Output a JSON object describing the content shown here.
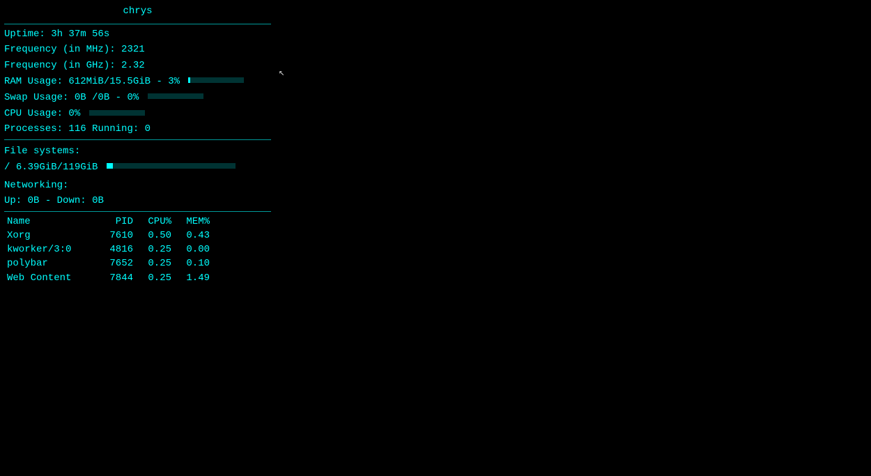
{
  "title": "chrys",
  "system": {
    "uptime_label": "Uptime:",
    "uptime_value": "3h 37m 56s",
    "freq_mhz_label": "Frequency (in MHz):",
    "freq_mhz_value": "2321",
    "freq_ghz_label": "Frequency (in GHz):",
    "freq_ghz_value": "2.32",
    "ram_label": "RAM Usage:",
    "ram_value": "612MiB/15.5GiB",
    "ram_pct": "- 3%",
    "ram_bar_pct": 3,
    "swap_label": "Swap Usage:",
    "swap_value": "0B  /0B",
    "swap_pct": "- 0%",
    "swap_bar_pct": 0,
    "cpu_label": "CPU Usage:",
    "cpu_pct": "0%",
    "cpu_bar_pct": 0,
    "proc_label": "Processes:",
    "proc_count": "116",
    "proc_running_label": "Running:",
    "proc_running": "0"
  },
  "filesystem": {
    "label": "File systems:",
    "entry": "/",
    "size": "6.39GiB/119GiB",
    "bar_pct": 5
  },
  "networking": {
    "label": "Networking:",
    "up_label": "Up:",
    "up_value": "0B",
    "down_label": "Down:",
    "down_value": "0B"
  },
  "processes": {
    "col_name": "Name",
    "col_pid": "PID",
    "col_cpu": "CPU%",
    "col_mem": "MEM%",
    "rows": [
      {
        "name": "Xorg",
        "pid": "7610",
        "cpu": "0.50",
        "mem": "0.43"
      },
      {
        "name": "kworker/3:0",
        "pid": "4816",
        "cpu": "0.25",
        "mem": "0.00"
      },
      {
        "name": "polybar",
        "pid": "7652",
        "cpu": "0.25",
        "mem": "0.10"
      },
      {
        "name": "Web Content",
        "pid": "7844",
        "cpu": "0.25",
        "mem": "1.49"
      }
    ]
  }
}
